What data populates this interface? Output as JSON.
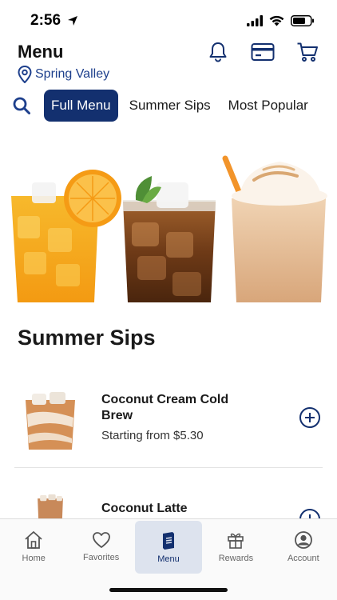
{
  "status_bar": {
    "time": "2:56"
  },
  "header": {
    "title": "Menu",
    "location": "Spring Valley",
    "icons": [
      "bell-icon",
      "card-icon",
      "cart-icon"
    ]
  },
  "tabs": {
    "search_icon": "search-icon",
    "items": [
      {
        "label": "Full Menu",
        "active": true
      },
      {
        "label": "Summer Sips",
        "active": false
      },
      {
        "label": "Most Popular",
        "active": false
      }
    ]
  },
  "section": {
    "title": "Summer Sips"
  },
  "products": [
    {
      "name": "Coconut Cream Cold Brew",
      "price_prefix": "Starting from",
      "price": "$5.30"
    },
    {
      "name": "Coconut Latte",
      "price_prefix": "",
      "price": ""
    }
  ],
  "bottom_nav": {
    "items": [
      {
        "label": "Home",
        "icon": "home-icon"
      },
      {
        "label": "Favorites",
        "icon": "heart-icon"
      },
      {
        "label": "Menu",
        "icon": "menu-book-icon",
        "active": true
      },
      {
        "label": "Rewards",
        "icon": "gift-icon"
      },
      {
        "label": "Account",
        "icon": "account-icon"
      }
    ]
  },
  "colors": {
    "primary": "#13306f",
    "accent_link": "#1d3f8c",
    "nav_active_bg": "#dde3ee"
  }
}
